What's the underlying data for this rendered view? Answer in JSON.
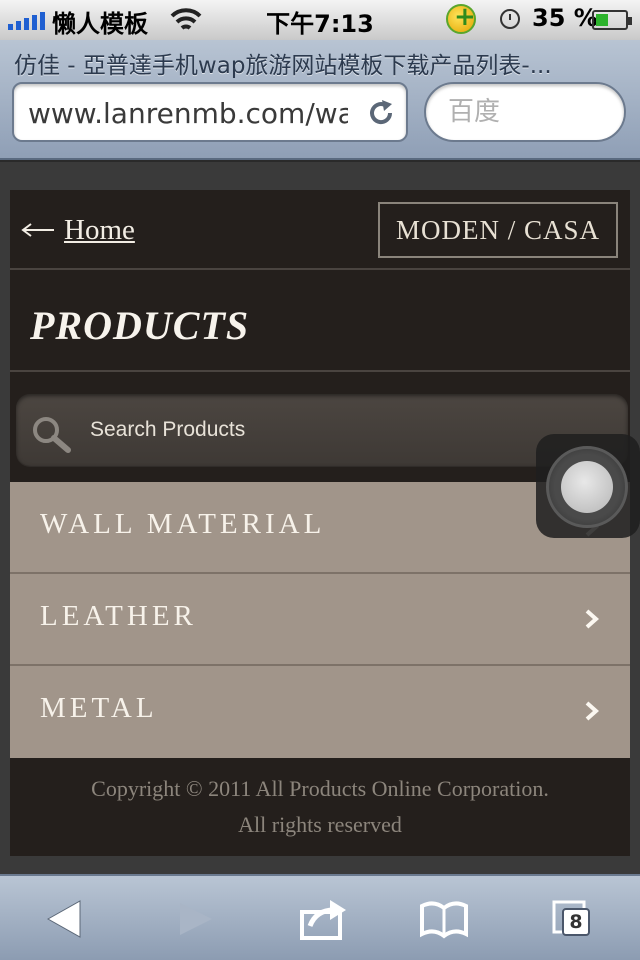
{
  "status_bar": {
    "carrier": "懒人模板",
    "time": "下午7:13",
    "battery_percent": "35 %"
  },
  "browser": {
    "page_title": "仿佳 - 亞普達手机wap旅游网站模板下载产品列表-...",
    "url": "www.lanrenmb.com/wap",
    "search_placeholder": "百度"
  },
  "site": {
    "home_link": "Home",
    "brand": "MODEN / CASA",
    "page_heading": "PRODUCTS",
    "search_placeholder": "Search Products",
    "categories": [
      {
        "label": "WALL MATERIAL"
      },
      {
        "label": "LEATHER"
      },
      {
        "label": "METAL"
      }
    ],
    "footer": {
      "copyright": "Copyright © 2011 All Products Online Corporation.",
      "rights": "All rights reserved"
    },
    "colors": {
      "background": "#241f1c",
      "category_bg": "#a1958a",
      "category_text": "#f7f2ea",
      "footer_text": "#8c857c"
    }
  },
  "toolbar": {
    "tab_count": "8"
  }
}
